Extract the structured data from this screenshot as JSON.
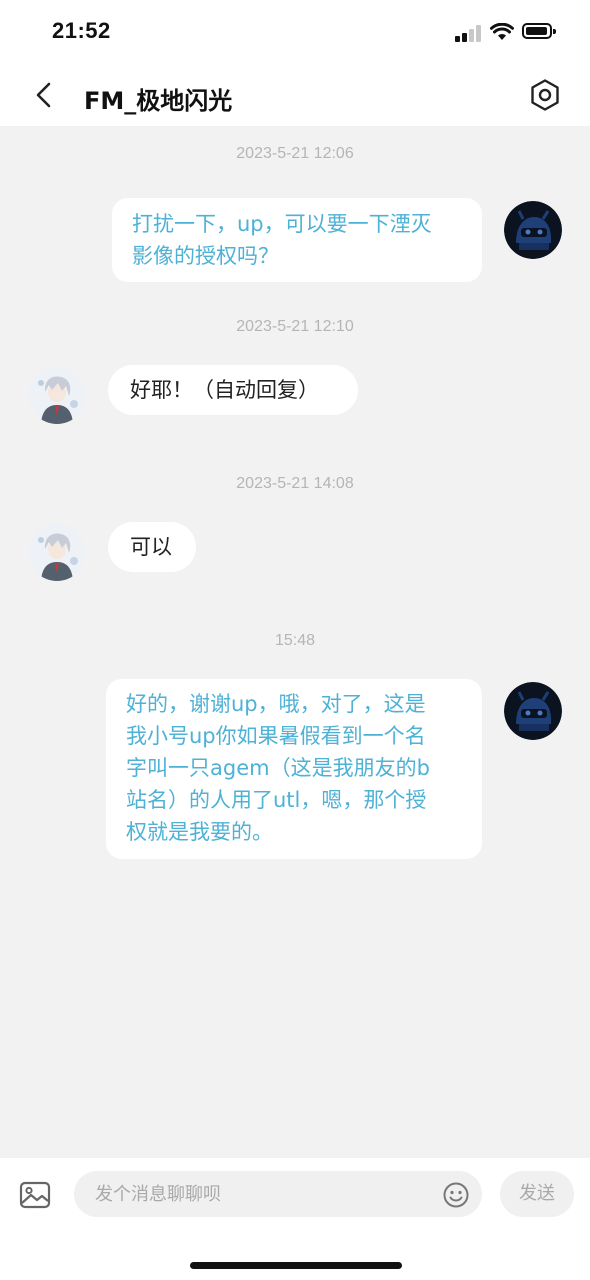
{
  "status_bar": {
    "time": "21:52"
  },
  "header": {
    "title": "FM_极地闪光"
  },
  "messages": [
    {
      "timestamp": "2023-5-21 12:06",
      "direction": "out",
      "text_lines": [
        "打扰一下，up，可以要一下湮灭",
        "影像的授权吗？"
      ]
    },
    {
      "timestamp": "2023-5-21 12:10",
      "direction": "in",
      "text_lines": [
        "好耶！（自动回复）"
      ]
    },
    {
      "timestamp": "2023-5-21 14:08",
      "direction": "in",
      "text_lines": [
        "可以"
      ]
    },
    {
      "timestamp": "15:48",
      "direction": "out",
      "text_lines": [
        "好的，谢谢up，哦，对了，这是",
        "我小号up你如果暑假看到一个名",
        "字叫一只agem（这是我朋友的b",
        "站名）的人用了utl，嗯，那个授",
        "权就是我要的。"
      ]
    }
  ],
  "composer": {
    "placeholder": "发个消息聊聊呗",
    "send_label": "发送"
  },
  "colors": {
    "outgoing_text": "#4eb1d6",
    "incoming_text": "#222222",
    "background": "#f2f2f2",
    "timestamp": "#b5b5b5"
  },
  "icons": {
    "back": "chevron-left-icon",
    "settings": "hexagon-settings-icon",
    "image": "image-icon",
    "emoji": "smile-icon"
  }
}
